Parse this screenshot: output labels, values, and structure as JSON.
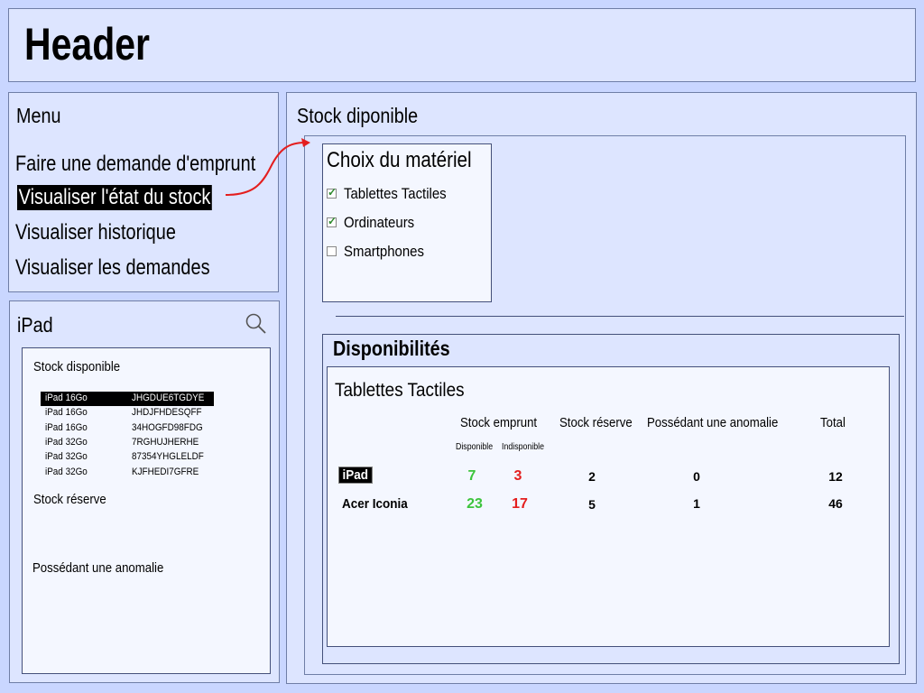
{
  "header": {
    "title": "Header"
  },
  "menu": {
    "title": "Menu",
    "items": [
      {
        "label": "Faire une demande d'emprunt"
      },
      {
        "label": "Visualiser l'état du stock"
      },
      {
        "label": "Visualiser historique"
      },
      {
        "label": "Visualiser les demandes"
      }
    ],
    "active_index": 1
  },
  "search_panel": {
    "title": "iPad",
    "icon": "search-icon",
    "sections": {
      "available": "Stock disponible",
      "reserve": "Stock réserve",
      "anomaly": "Possédant une anomalie"
    },
    "items": [
      {
        "model": "iPad 16Go",
        "serial": "JHGDUE6TGDYE"
      },
      {
        "model": "iPad 16Go",
        "serial": "JHDJFHDESQFF"
      },
      {
        "model": "iPad 16Go",
        "serial": "34HOGFD98FDG"
      },
      {
        "model": "iPad 32Go",
        "serial": "7RGHUJHERHE"
      },
      {
        "model": "iPad 32Go",
        "serial": "87354YHGLELDF"
      },
      {
        "model": "iPad 32Go",
        "serial": "KJFHEDI7GFRE"
      }
    ],
    "selected_index": 0
  },
  "main": {
    "title": "Stock diponible",
    "choice": {
      "title": "Choix du matériel",
      "options": [
        {
          "label": "Tablettes Tactiles",
          "checked": true
        },
        {
          "label": "Ordinateurs",
          "checked": true
        },
        {
          "label": "Smartphones",
          "checked": false
        }
      ]
    },
    "dispo": {
      "title": "Disponibilités",
      "category": "Tablettes Tactiles",
      "headers": {
        "stock_emprunt": "Stock emprunt",
        "disponible": "Disponible",
        "indisponible": "Indisponible",
        "stock_reserve": "Stock réserve",
        "anomalie": "Possédant une anomalie",
        "total": "Total"
      },
      "rows": [
        {
          "name": "iPad",
          "disponible": "7",
          "indisponible": "3",
          "reserve": "2",
          "anomalie": "0",
          "total": "12"
        },
        {
          "name": "Acer Iconia",
          "disponible": "23",
          "indisponible": "17",
          "reserve": "5",
          "anomalie": "1",
          "total": "46"
        }
      ]
    }
  },
  "colors": {
    "background": "#c9d6ff",
    "panel": "#dde5ff",
    "box": "#f4f7ff",
    "available_green": "#3cc43c",
    "unavailable_red": "#e41e1e",
    "arrow_red": "#e41e1e"
  }
}
